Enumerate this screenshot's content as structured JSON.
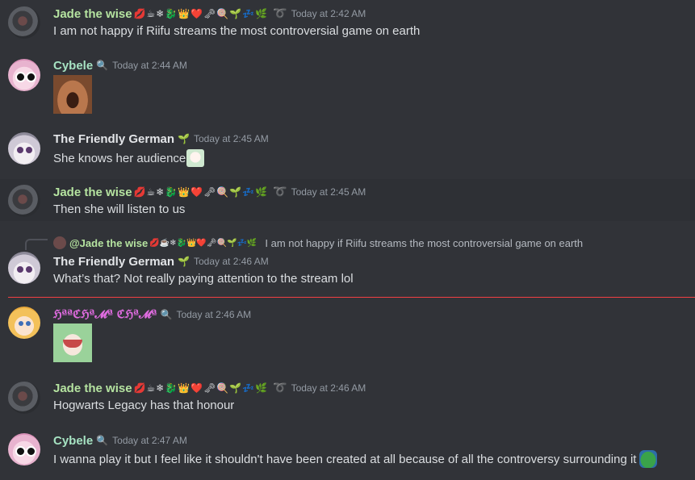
{
  "messages": [
    {
      "author": "Jade the wise",
      "badges": "💋☕❄🐉👑❤️🗝🍭🌱💤🌿",
      "title_icon": "➰",
      "timestamp": "Today at 2:42 AM",
      "text": "I am not happy if Riifu streams the most controversial game on earth"
    },
    {
      "author": "Cybele",
      "badges": "🔍",
      "timestamp": "Today at 2:44 AM",
      "text": ""
    },
    {
      "author": "The Friendly German",
      "badges": "🌱",
      "timestamp": "Today at 2:45 AM",
      "text": "She knows her audience"
    },
    {
      "author": "Jade the wise",
      "badges": "💋☕❄🐉👑❤️🗝🍭🌱💤🌿",
      "title_icon": "➰",
      "timestamp": "Today at 2:45 AM",
      "text": "Then she will listen to us"
    },
    {
      "reply_author": "@Jade the wise",
      "reply_badges": "💋☕❄🐉👑❤️🗝🍭🌱💤🌿",
      "reply_text": "I am not happy if Riifu streams the most controversial game on earth",
      "author": "The Friendly German",
      "badges": "🌱",
      "timestamp": "Today at 2:46 AM",
      "text": "What’s that? Not really paying attention to the stream lol"
    },
    {
      "author": "ℌªªℭℌª𝓜ª ℭℌª𝓜ª",
      "badges": "🔍",
      "timestamp": "Today at 2:46 AM",
      "text": ""
    },
    {
      "author": "Jade the wise",
      "badges": "💋☕❄🐉👑❤️🗝🍭🌱💤🌿",
      "title_icon": "➰",
      "timestamp": "Today at 2:46 AM",
      "text": "Hogwarts Legacy has that honour"
    },
    {
      "author": "Cybele",
      "badges": "🔍",
      "timestamp": "Today at 2:47 AM",
      "text": "I wanna play it but I feel like it shouldn't have been created at all because of all the controversy surrounding it"
    }
  ]
}
